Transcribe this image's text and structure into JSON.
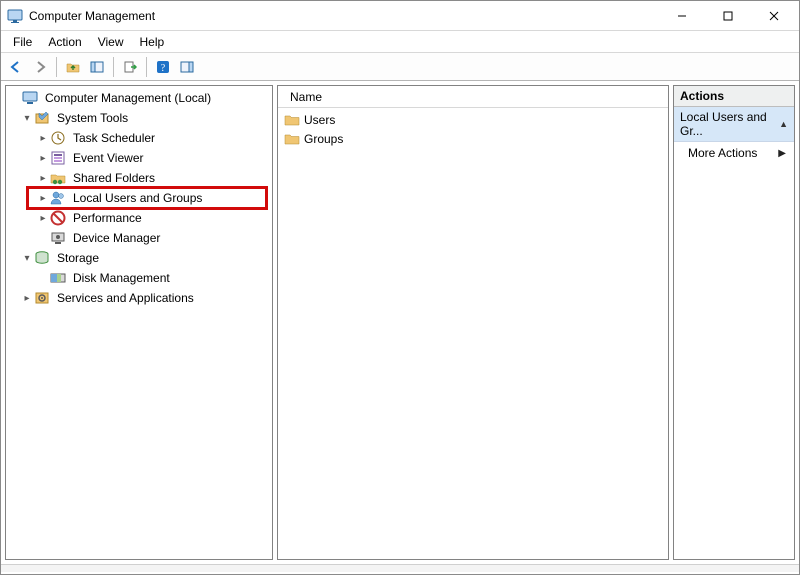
{
  "window": {
    "title": "Computer Management"
  },
  "menu": {
    "file": "File",
    "action": "Action",
    "view": "View",
    "help": "Help"
  },
  "tree": {
    "root": "Computer Management (Local)",
    "system_tools": "System Tools",
    "task_scheduler": "Task Scheduler",
    "event_viewer": "Event Viewer",
    "shared_folders": "Shared Folders",
    "local_users_groups": "Local Users and Groups",
    "performance": "Performance",
    "device_manager": "Device Manager",
    "storage": "Storage",
    "disk_management": "Disk Management",
    "services_apps": "Services and Applications"
  },
  "list": {
    "header_name": "Name",
    "items": {
      "users": "Users",
      "groups": "Groups"
    }
  },
  "actions": {
    "title": "Actions",
    "group_label": "Local Users and Gr...",
    "more_actions": "More Actions"
  }
}
